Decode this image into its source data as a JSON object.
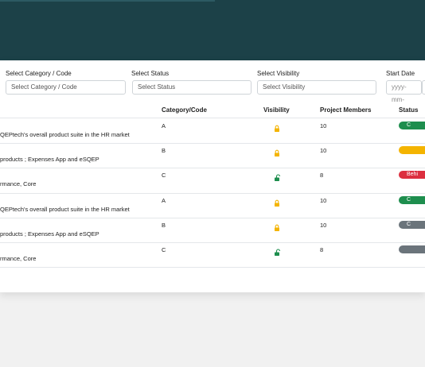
{
  "filters": {
    "category": {
      "label": "Select Category / Code",
      "placeholder": "Select Category / Code"
    },
    "status": {
      "label": "Select Status",
      "placeholder": "Select Status"
    },
    "visibility": {
      "label": "Select Visibility",
      "placeholder": "Select Visibility"
    },
    "start_date": {
      "label": "Start Date",
      "placeholder": "yyyy-mm-"
    }
  },
  "table": {
    "headers": {
      "category": "Category/Code",
      "visibility": "Visibility",
      "members": "Project Members",
      "status": "Status"
    },
    "rows": [
      {
        "description": "QEPtech's overall product suite in the HR market",
        "category": "A",
        "visibility": "locked",
        "members": "10",
        "status": "C",
        "status_color": "#1e8e4e"
      },
      {
        "description": "products ; Expenses App and eSQEP",
        "category": "B",
        "visibility": "locked",
        "members": "10",
        "status": "",
        "status_color": "#f4b400"
      },
      {
        "description": "rmance, Core",
        "category": "C",
        "visibility": "unlocked",
        "members": "8",
        "status": "Behi",
        "status_color": "#dc2f3f"
      },
      {
        "description": "QEPtech's overall product suite in the HR market",
        "category": "A",
        "visibility": "locked",
        "members": "10",
        "status": "C",
        "status_color": "#1e8e4e"
      },
      {
        "description": "products ; Expenses App and eSQEP",
        "category": "B",
        "visibility": "locked",
        "members": "10",
        "status": "C",
        "status_color": "#6b747b"
      },
      {
        "description": "rmance, Core",
        "category": "C",
        "visibility": "unlocked",
        "members": "8",
        "status": "",
        "status_color": "#6b747b"
      }
    ]
  },
  "colors": {
    "header_band": "#1c4148",
    "locked_icon": "#f4b400",
    "unlocked_icon": "#1e8e4e"
  },
  "icons": {
    "locked": "lock-icon",
    "unlocked": "unlock-icon"
  }
}
